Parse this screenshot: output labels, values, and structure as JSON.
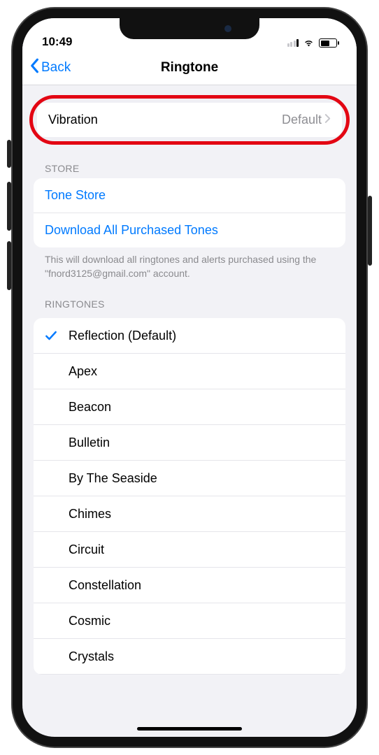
{
  "status": {
    "time": "10:49"
  },
  "nav": {
    "back_label": "Back",
    "title": "Ringtone"
  },
  "vibration": {
    "label": "Vibration",
    "value": "Default"
  },
  "store": {
    "header": "STORE",
    "tone_store": "Tone Store",
    "download_all": "Download All Purchased Tones",
    "footer": "This will download all ringtones and alerts purchased using the \"fnord3125@gmail.com\" account."
  },
  "ringtones": {
    "header": "RINGTONES",
    "items": [
      {
        "label": "Reflection (Default)",
        "selected": true
      },
      {
        "label": "Apex",
        "selected": false
      },
      {
        "label": "Beacon",
        "selected": false
      },
      {
        "label": "Bulletin",
        "selected": false
      },
      {
        "label": "By The Seaside",
        "selected": false
      },
      {
        "label": "Chimes",
        "selected": false
      },
      {
        "label": "Circuit",
        "selected": false
      },
      {
        "label": "Constellation",
        "selected": false
      },
      {
        "label": "Cosmic",
        "selected": false
      },
      {
        "label": "Crystals",
        "selected": false
      }
    ]
  }
}
